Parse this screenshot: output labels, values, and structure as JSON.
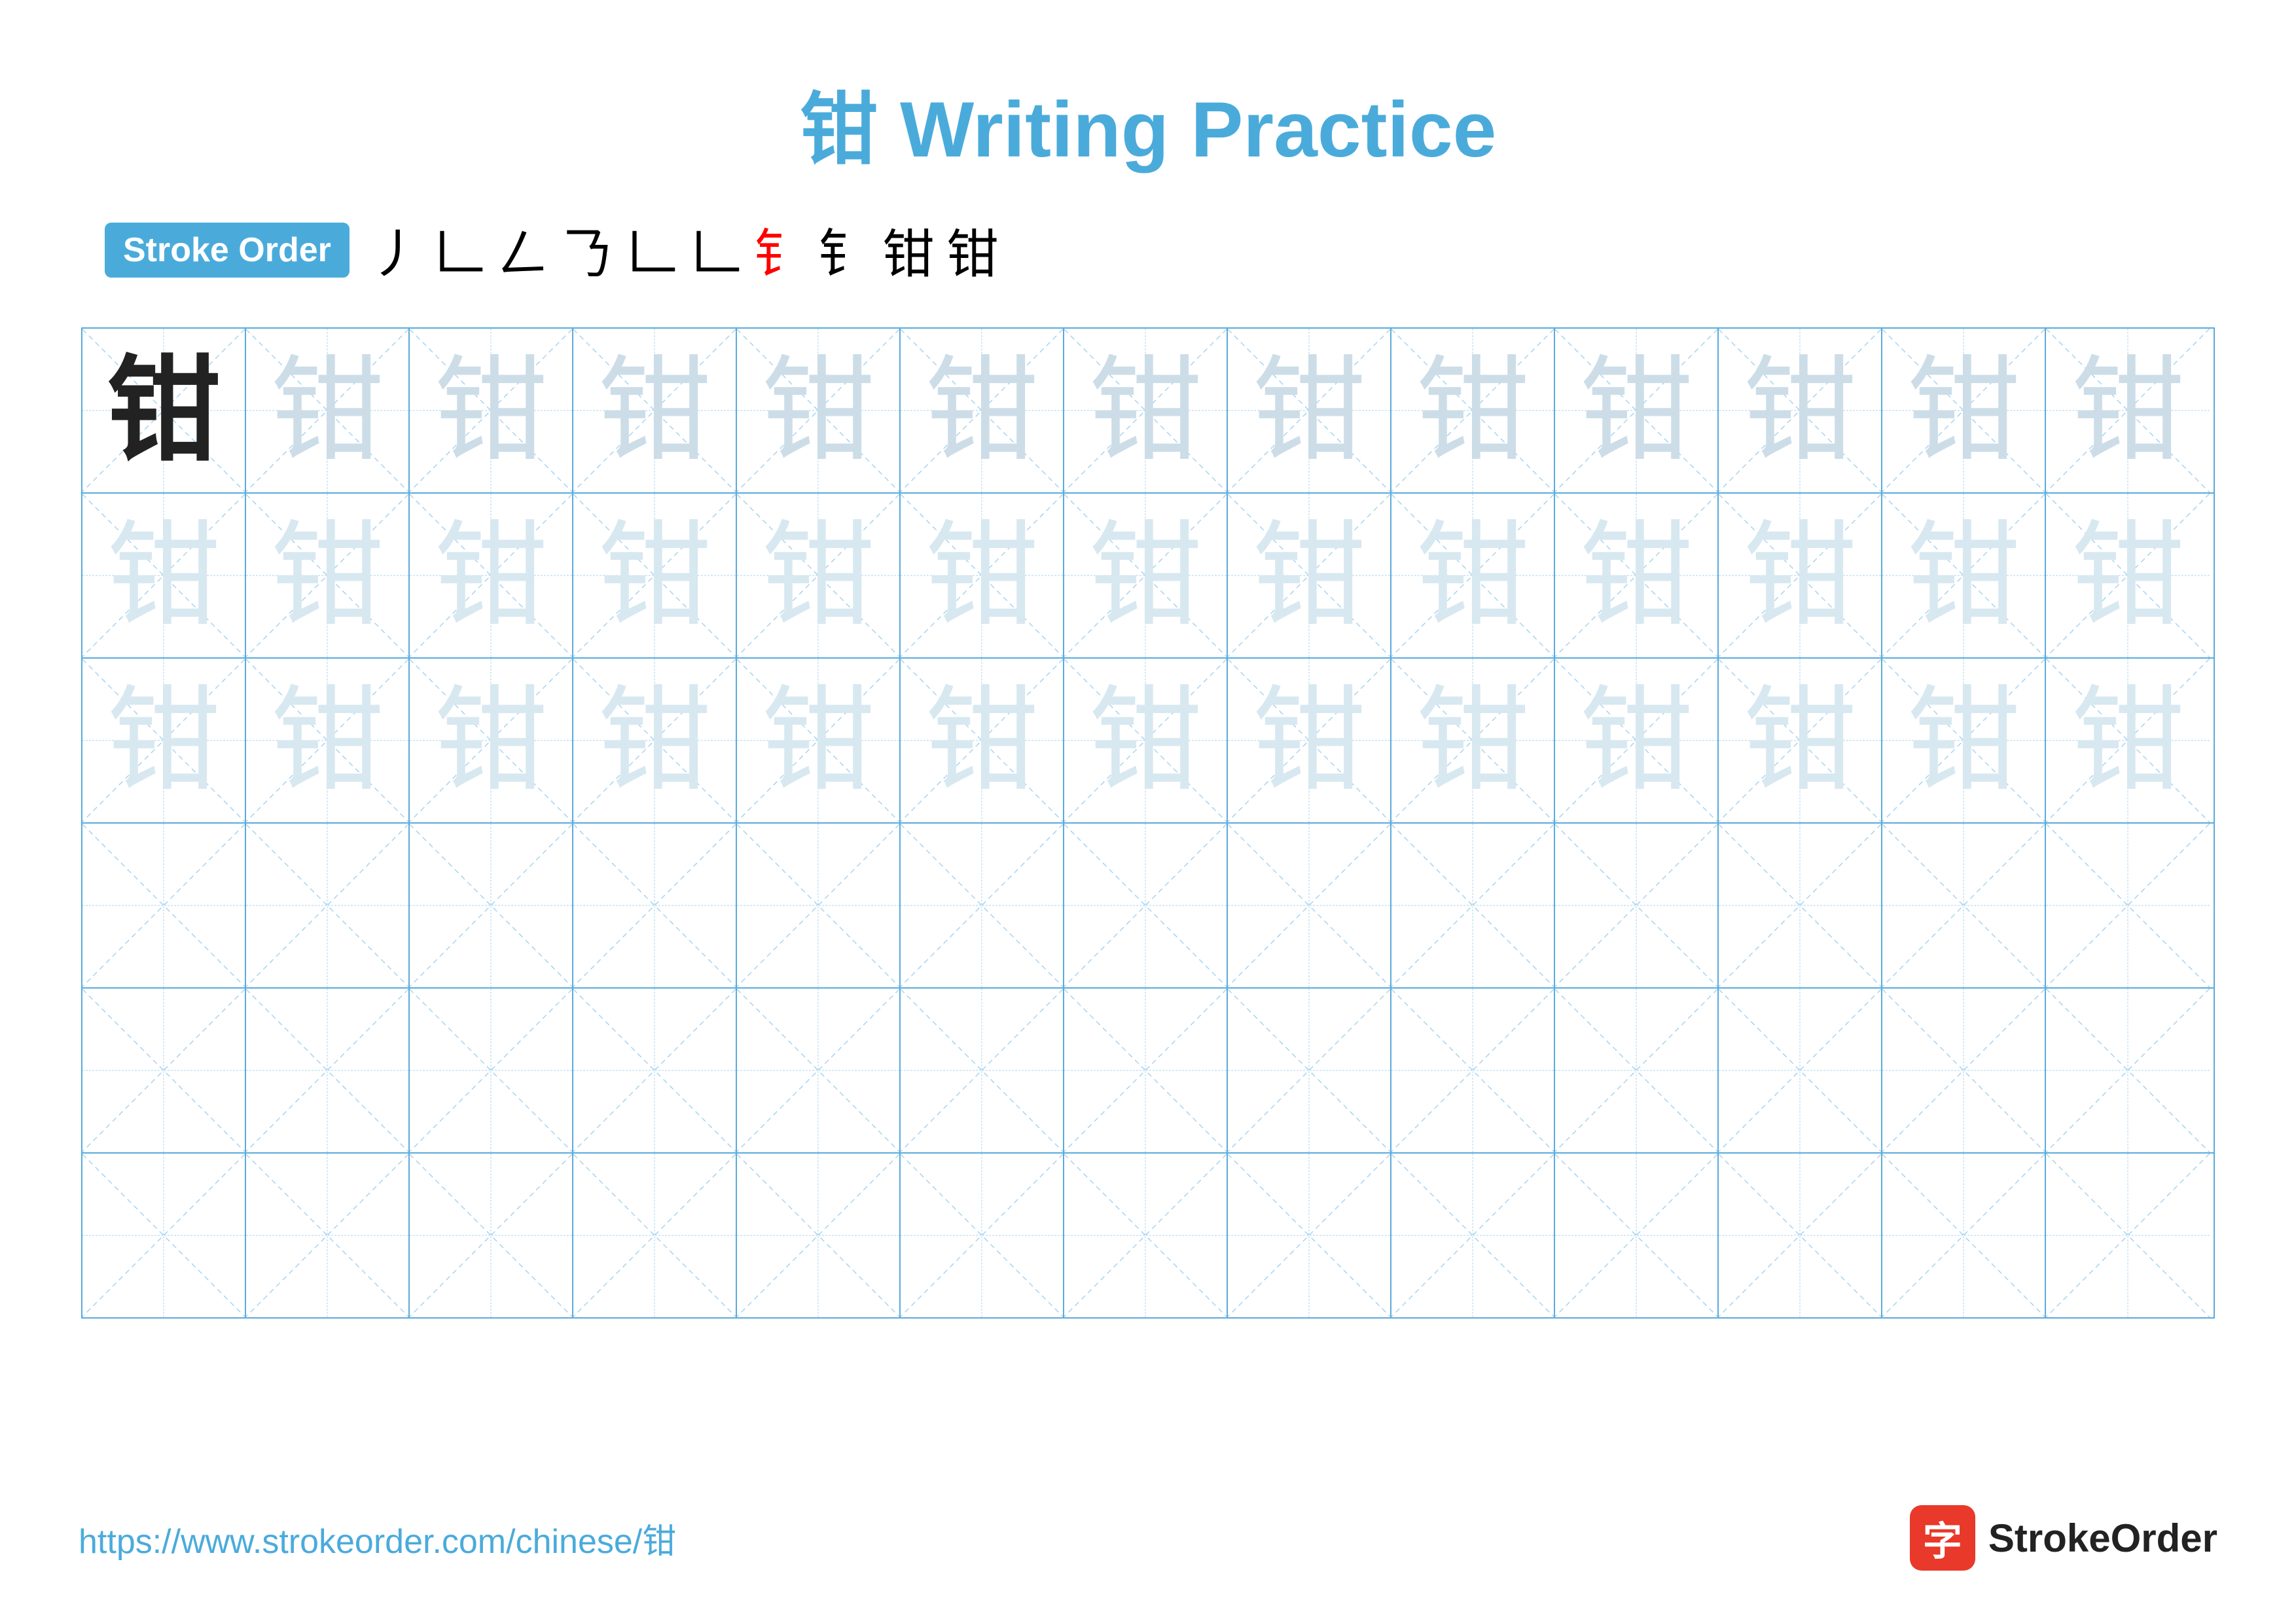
{
  "title": "钳 Writing Practice",
  "stroke_order_badge": "Stroke Order",
  "stroke_sequence": [
    "丿",
    "㇀",
    "𠃋",
    "𠃊",
    "𠄎",
    "𠄎+",
    "钅-",
    "钅",
    "钳-",
    "钳"
  ],
  "stroke_sequence_colors": [
    "black",
    "black",
    "black",
    "black",
    "black",
    "black",
    "red",
    "black",
    "black",
    "black"
  ],
  "character": "钳",
  "rows": [
    {
      "type": "dark_then_light",
      "dark_count": 1,
      "light_count": 12
    },
    {
      "type": "all_lighter",
      "count": 13
    },
    {
      "type": "all_lighter",
      "count": 13
    },
    {
      "type": "empty",
      "count": 13
    },
    {
      "type": "empty",
      "count": 13
    },
    {
      "type": "empty",
      "count": 13
    }
  ],
  "footer_url": "https://www.strokeorder.com/chinese/钳",
  "footer_logo_char": "字",
  "footer_logo_text": "StrokeOrder"
}
